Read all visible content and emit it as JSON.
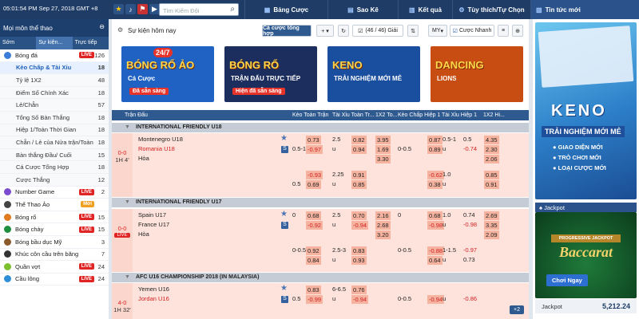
{
  "topbar": {
    "clock": "05:01:54 PM Sep 27, 2018 GMT +8",
    "search_placeholder": "Tìm Kiếm Đội",
    "tabs": [
      "Bảng Cược",
      "Sao Kê",
      "Kết quả",
      "Tùy thích/Tự Chọn"
    ]
  },
  "left": {
    "header": "Mọi môn thể thao",
    "tabs": [
      "Sớm",
      "Sự kiện...",
      "Trực tiếp"
    ],
    "sports": [
      {
        "name": "Bóng đá",
        "live": "LIVE",
        "count": "126",
        "color": "#3b7dd8"
      },
      {
        "sub": true,
        "name": "Kèo Chấp & Tài Xỉu",
        "count": "18",
        "sel": true
      },
      {
        "sub": true,
        "name": "Tỷ lệ 1X2",
        "count": "48"
      },
      {
        "sub": true,
        "name": "Điểm Số Chính Xác",
        "count": "18"
      },
      {
        "sub": true,
        "name": "Lẻ/Chẵn",
        "count": "57"
      },
      {
        "sub": true,
        "name": "Tổng Số Bàn Thắng",
        "count": "18"
      },
      {
        "sub": true,
        "name": "Hiệp 1/Toàn Thời Gian",
        "count": "18"
      },
      {
        "sub": true,
        "name": "Chẵn / Lẻ của Nửa trận/Toàn",
        "count": "18"
      },
      {
        "sub": true,
        "name": "Bàn thắng Đầu/ Cuối",
        "count": "15"
      },
      {
        "sub": true,
        "name": "Cá Cược Tổng Hợp",
        "count": "18"
      },
      {
        "sub": true,
        "name": "Cược Thắng",
        "count": "12"
      },
      {
        "name": "Number Game",
        "live": "LIVE",
        "count": "2",
        "color": "#7b4bd0"
      },
      {
        "name": "Thể Thao Ảo",
        "badge": "Mới",
        "count": "",
        "color": "#444"
      },
      {
        "name": "Bóng rổ",
        "live": "LIVE",
        "count": "15",
        "color": "#e07a1f"
      },
      {
        "name": "Bóng chày",
        "live": "LIVE",
        "count": "15",
        "color": "#1d8f3f"
      },
      {
        "name": "Bóng bầu dục Mỹ",
        "count": "3",
        "color": "#8a5a2b"
      },
      {
        "name": "Khúc côn cầu trên băng",
        "count": "7",
        "color": "#333"
      },
      {
        "name": "Quần vợt",
        "live": "LIVE",
        "count": "24",
        "color": "#7cc12d"
      },
      {
        "name": "Cầu lông",
        "live": "LIVE",
        "count": "24",
        "color": "#2e8fd6"
      }
    ]
  },
  "center": {
    "title": "Sự kiện hôm nay",
    "combo_btn": "Cá cược tổng hợp",
    "league_count": "(46 / 46) Giải",
    "odds_type": "MY",
    "fast_bet": "Cược Nhanh",
    "banners": [
      {
        "line1": "BÓNG RỔ ẢO",
        "line2": "Cá Cược",
        "line3": "Đã sẵn sàng",
        "badge": "24/7",
        "bg": "#1f62c4"
      },
      {
        "line1": "BÓNG RỔ",
        "line2": "TRẬN ĐẤU TRỰC TIẾP",
        "line3": "Hiện đã sẵn sàng",
        "badge": "",
        "bg": "#1b2e5e"
      },
      {
        "line1": "KENO",
        "line2": "TRẢI NGHIỆM MỚI MẺ",
        "line3": "",
        "badge": "",
        "bg": "#1a4fa0"
      },
      {
        "line1": "DANCING",
        "line2": "LIONS",
        "line3": "",
        "badge": "",
        "bg": "#c84d12"
      }
    ],
    "columns": [
      "Trận Đấu",
      "Kèo Toàn Trận",
      "Tài Xỉu Toàn Tr...",
      "1X2 To...",
      "Kèo Chấp Hiệp 1",
      "Tài Xỉu Hiệp 1",
      "1X2 Hi..."
    ],
    "leagues": [
      {
        "name": "INTERNATIONAL FRIENDLY U18"
      },
      {
        "name": "INTERNATIONAL FRIENDLY U17"
      },
      {
        "name": "AFC U16 CHAMPIONSHIP 2018 (IN MALAYSIA)"
      }
    ],
    "matches": [
      {
        "score": "0-0",
        "time": "1H 4'",
        "home": "Montenegro U18",
        "away": "Romania U18",
        "draw": "Hòa",
        "r1": [
          "",
          "0.73",
          "2.5",
          "0.82",
          "3.95",
          "",
          "0.87",
          "0.5-1",
          "0.5",
          "4.35"
        ],
        "r2": [
          "0.5-1",
          "-0.97",
          "u",
          "0.94",
          "1.69",
          "0-0.5",
          "0.89",
          "u",
          "-0.74",
          "2.30"
        ],
        "r3": [
          "",
          "",
          "",
          "",
          "3.30",
          "",
          "",
          "",
          "",
          "2.06"
        ],
        "r4": [
          "",
          "-0.93",
          "2.25",
          "0.91",
          "",
          "",
          "-0.62",
          "1.0",
          "",
          "0.85"
        ],
        "r5": [
          "0.5",
          "0.69",
          "u",
          "0.85",
          "",
          "",
          "0.38",
          "u",
          "",
          "0.91"
        ]
      },
      {
        "score": "0-0",
        "time": "LIVE",
        "home": "Spain U17",
        "away": "France U17",
        "draw": "Hòa",
        "r1": [
          "0",
          "0.68",
          "2.5",
          "0.70",
          "2.16",
          "0",
          "0.68",
          "1.0",
          "0.74",
          "2.69"
        ],
        "r2": [
          "",
          "-0.92",
          "u",
          "-0.94",
          "2.68",
          "",
          "-0.98",
          "u",
          "-0.98",
          "3.35"
        ],
        "r3": [
          "",
          "",
          "",
          "",
          "3.20",
          "",
          "",
          "",
          "",
          "2.09"
        ],
        "r4": [
          "0-0.5",
          "0.92",
          "2.5-3",
          "0.83",
          "",
          "0-0.5",
          "-0.88",
          "1-1.5",
          "-0.97",
          ""
        ],
        "r5": [
          "",
          "0.84",
          "u",
          "0.93",
          "",
          "",
          "0.64",
          "u",
          "0.73",
          ""
        ]
      },
      {
        "score": "4-0",
        "time": "1H 32'",
        "home": "Yemen U16",
        "away": "Jordan U16",
        "draw": "",
        "r1": [
          "",
          "0.83",
          "6-6.5",
          "0.76",
          "",
          "",
          "",
          "",
          "",
          ""
        ],
        "r2": [
          "0.5",
          "-0.99",
          "u",
          "-0.94",
          "",
          "0-0.5",
          "-0.94",
          "u",
          "-0.86",
          ""
        ]
      }
    ],
    "more": "+2"
  },
  "right": {
    "header": "Tin tức mới",
    "keno_title": "KENO",
    "keno_sub": "TRẢI NGHIỆM MỚI MẺ",
    "keno_items": [
      "GIAO DIỆN MỚI",
      "TRÒ CHƠI MỚI",
      "LOẠI CƯỢC MỚI"
    ],
    "jackpot_header": "Jackpot",
    "baccarat_top": "PROGRESSIVE JACKPOT",
    "baccarat": "Baccarat",
    "play_now": "Chơi Ngay",
    "jackpot_label": "Jackpot",
    "jackpot_value": "5,212.24"
  }
}
